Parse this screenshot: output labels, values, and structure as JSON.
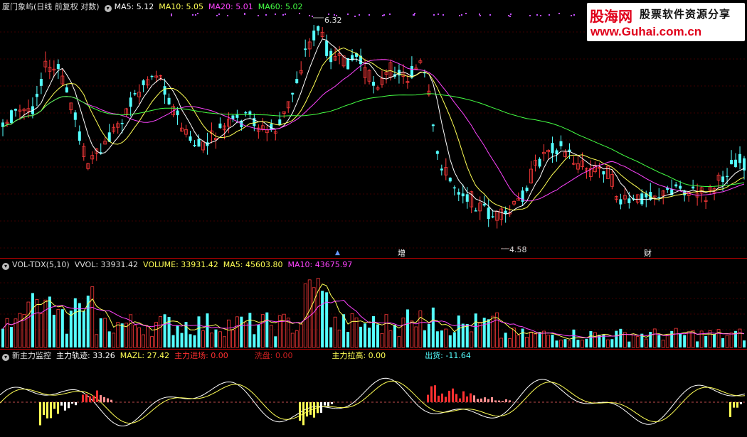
{
  "main": {
    "title": "厦门象屿(日线 前复权 对数)",
    "ma": [
      {
        "label": "MA5: 5.12",
        "color": "#ffffff"
      },
      {
        "label": "MA10: 5.05",
        "color": "#ffff55"
      },
      {
        "label": "MA20: 5.01",
        "color": "#ff44ff"
      },
      {
        "label": "MA60: 5.02",
        "color": "#44ff44"
      }
    ],
    "high_label": "6.32",
    "low_label": "4.58",
    "marker_zeng": "增",
    "marker_cai": "财"
  },
  "volume": {
    "title": "VOL-TDX(5,10)",
    "items": [
      {
        "label": "VVOL: 33931.42",
        "color": "#dddddd"
      },
      {
        "label": "VOLUME: 33931.42",
        "color": "#ffff55"
      },
      {
        "label": "MA5: 45603.80",
        "color": "#ffff55"
      },
      {
        "label": "MA10: 43675.97",
        "color": "#ff44ff"
      }
    ]
  },
  "indicator": {
    "title": "新主力监控",
    "items": [
      {
        "label": "主力轨迹: 33.26",
        "color": "#ffffff"
      },
      {
        "label": "MAZL: 27.42",
        "color": "#ffff55"
      },
      {
        "label": "主力进场: 0.00",
        "color": "#ff3030"
      },
      {
        "label": "洗盘: 0.00",
        "color": "#cc2020"
      },
      {
        "label": "主力拉高: 0.00",
        "color": "#ffff55"
      },
      {
        "label": "出货: -11.64",
        "color": "#55ffff"
      }
    ]
  },
  "logo": {
    "name": "股海网",
    "tagline": "股票软件资源分享",
    "url": "www.Guhai.com.cn"
  },
  "colors": {
    "up": "#ff3a3a",
    "down": "#54ffff",
    "grid": "#7a0000",
    "separator": "#b00000"
  }
}
